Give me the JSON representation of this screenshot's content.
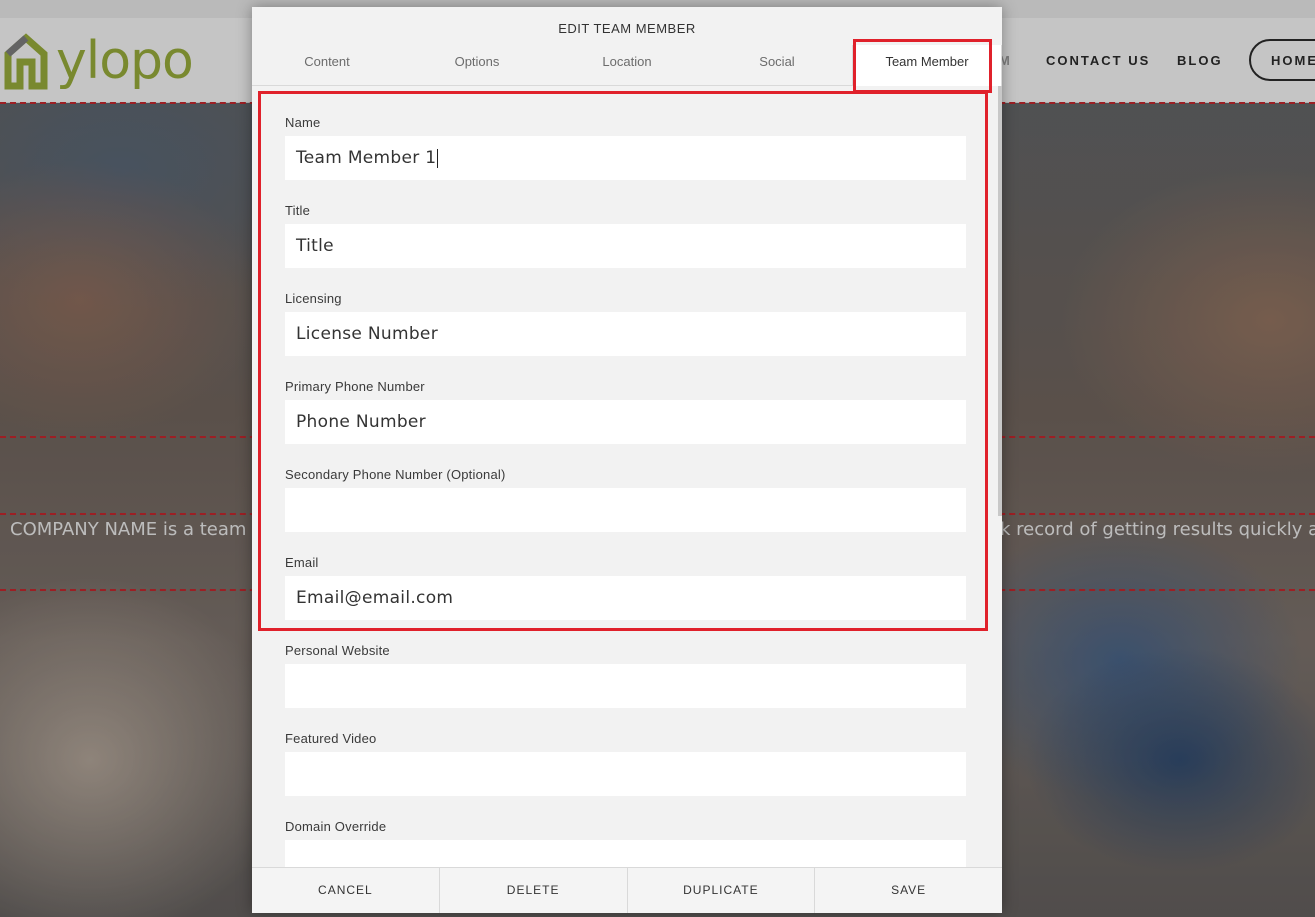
{
  "site": {
    "logo_text": "ylopo",
    "nav_partial": "M",
    "nav_contact": "CONTACT US",
    "nav_blog": "BLOG",
    "nav_home": "HOME",
    "company_text_left": "COMPANY NAME is a team of",
    "company_text_right": "k record of getting results quickly and"
  },
  "modal": {
    "title": "EDIT TEAM MEMBER",
    "tabs": [
      {
        "label": "Content"
      },
      {
        "label": "Options"
      },
      {
        "label": "Location"
      },
      {
        "label": "Social"
      },
      {
        "label": "Team Member",
        "active": true
      }
    ],
    "fields": [
      {
        "label": "Name",
        "value": "Team Member 1",
        "placeholder": ""
      },
      {
        "label": "Title",
        "value": "",
        "placeholder": "Title"
      },
      {
        "label": "Licensing",
        "value": "",
        "placeholder": "License Number"
      },
      {
        "label": "Primary Phone Number",
        "value": "",
        "placeholder": "Phone Number"
      },
      {
        "label": "Secondary Phone Number (Optional)",
        "value": "",
        "placeholder": ""
      },
      {
        "label": "Email",
        "value": "",
        "placeholder": "Email@email.com"
      },
      {
        "label": "Personal Website",
        "value": "",
        "placeholder": ""
      },
      {
        "label": "Featured Video",
        "value": "",
        "placeholder": ""
      },
      {
        "label": "Domain Override",
        "value": "",
        "placeholder": ""
      }
    ],
    "footer": {
      "cancel": "CANCEL",
      "delete": "DELETE",
      "duplicate": "DUPLICATE",
      "save": "SAVE"
    }
  },
  "colors": {
    "highlight": "#e0212b",
    "logo_green": "#94a83a",
    "dashed_guides": "#c0262d"
  },
  "icons": [
    "house-logo-icon"
  ]
}
